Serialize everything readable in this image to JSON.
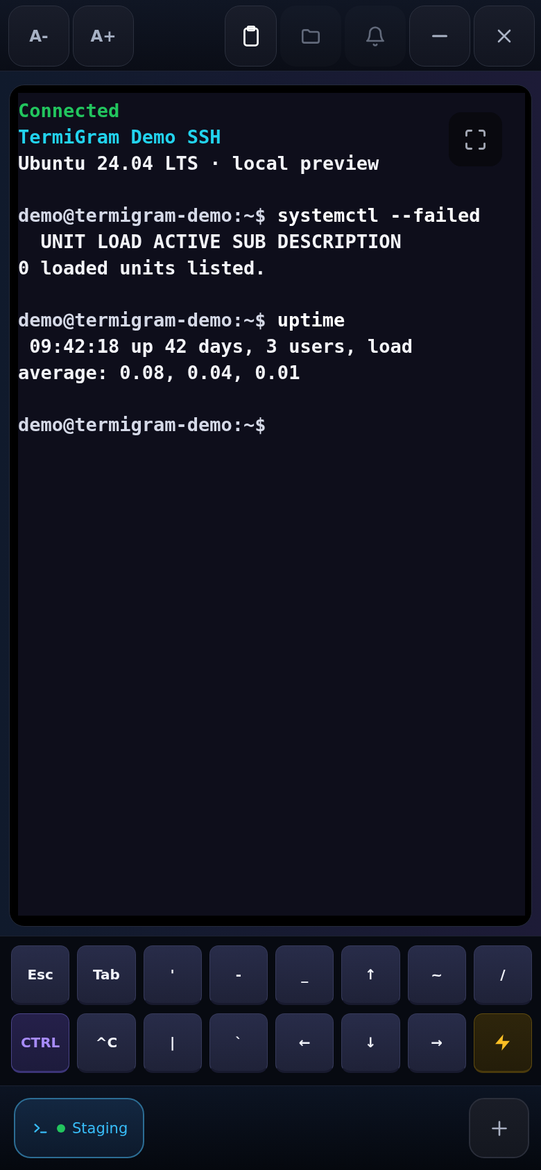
{
  "toolbar": {
    "left_buttons": [
      {
        "label": "A-",
        "disabled": false
      },
      {
        "label": "A+",
        "disabled": false
      }
    ],
    "right_buttons": [
      {
        "disabled": false
      },
      {
        "disabled": true
      },
      {
        "disabled": true
      },
      {
        "disabled": false
      },
      {
        "disabled": false
      }
    ]
  },
  "terminal": {
    "lines": [
      {
        "kind": "status",
        "text": "Connected"
      },
      {
        "kind": "title",
        "text": "TermiGram Demo SSH"
      },
      {
        "kind": "output",
        "text": "Ubuntu 24.04 LTS · local preview"
      },
      {
        "kind": "blank"
      },
      {
        "kind": "command",
        "prompt": "demo@termigram-demo:~$",
        "command": "systemctl --failed"
      },
      {
        "kind": "output",
        "text": "  UNIT LOAD ACTIVE SUB DESCRIPTION"
      },
      {
        "kind": "output",
        "text": "0 loaded units listed."
      },
      {
        "kind": "blank"
      },
      {
        "kind": "command",
        "prompt": "demo@termigram-demo:~$",
        "command": "uptime"
      },
      {
        "kind": "output",
        "text": " 09:42:18 up 42 days, 3 users, load"
      },
      {
        "kind": "output",
        "text": "average: 0.08, 0.04, 0.01"
      },
      {
        "kind": "blank"
      },
      {
        "kind": "command",
        "prompt": "demo@termigram-demo:~$"
      }
    ]
  },
  "keys": [
    [
      {
        "kind": "key",
        "label": "Esc"
      },
      {
        "kind": "key",
        "label": "Tab"
      },
      {
        "kind": "key",
        "label": "'"
      },
      {
        "kind": "key",
        "label": "-"
      },
      {
        "kind": "key",
        "label": "_"
      },
      {
        "kind": "key",
        "label": "↑"
      },
      {
        "kind": "key",
        "label": "~"
      },
      {
        "kind": "key",
        "label": "/"
      }
    ],
    [
      {
        "kind": "modifier",
        "label": "CTRL"
      },
      {
        "kind": "key",
        "label": "^C"
      },
      {
        "kind": "key",
        "label": "|"
      },
      {
        "kind": "key",
        "label": "`"
      },
      {
        "kind": "key",
        "label": "←"
      },
      {
        "kind": "key",
        "label": "↓"
      },
      {
        "kind": "key",
        "label": "→"
      },
      {
        "kind": "action"
      }
    ]
  ],
  "tabs": [
    {
      "label": "Staging",
      "selected": true,
      "color": "#22c55e"
    }
  ]
}
